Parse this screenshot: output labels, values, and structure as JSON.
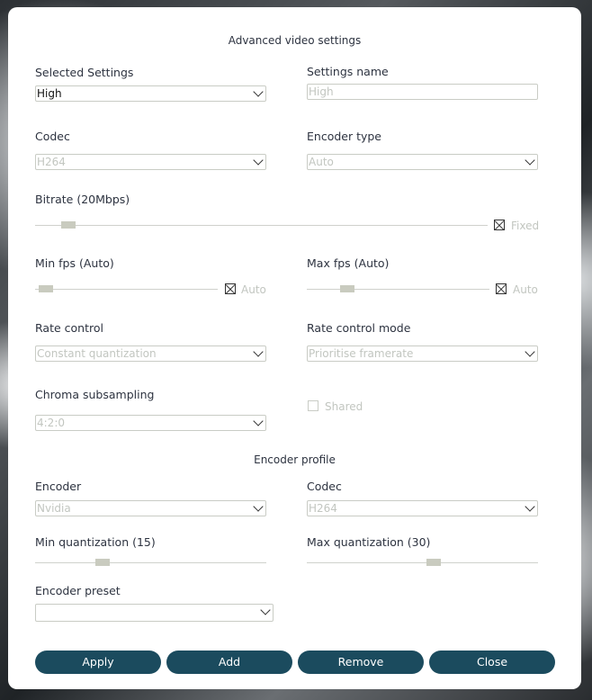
{
  "title": "Advanced video settings",
  "selected_settings": {
    "label": "Selected Settings",
    "value": "High"
  },
  "settings_name": {
    "label": "Settings name",
    "placeholder": "High"
  },
  "codec": {
    "label": "Codec",
    "value": "H264"
  },
  "encoder_type": {
    "label": "Encoder type",
    "value": "Auto"
  },
  "bitrate": {
    "label": "Bitrate (20Mbps)",
    "check_label": "Fixed",
    "level": 0.06
  },
  "min_fps": {
    "label": "Min fps (Auto)",
    "check_label": "Auto",
    "level": 0.02
  },
  "max_fps": {
    "label": "Max fps (Auto)",
    "check_label": "Auto",
    "level": 0.2
  },
  "rate_control": {
    "label": "Rate control",
    "value": "Constant quantization"
  },
  "rate_control_mode": {
    "label": "Rate control mode",
    "value": "Prioritise framerate"
  },
  "chroma": {
    "label": "Chroma subsampling",
    "value": "4:2:0"
  },
  "shared": {
    "label": "Shared"
  },
  "encoder_profile_title": "Encoder profile",
  "encoder": {
    "label": "Encoder",
    "value": "Nvidia"
  },
  "profile_codec": {
    "label": "Codec",
    "value": "H264"
  },
  "min_quant": {
    "label": "Min quantization (15)",
    "level": 0.28
  },
  "max_quant": {
    "label": "Max quantization (30)",
    "level": 0.55
  },
  "encoder_preset": {
    "label": "Encoder preset",
    "value": ""
  },
  "buttons": {
    "apply": "Apply",
    "add": "Add",
    "remove": "Remove",
    "close": "Close"
  }
}
